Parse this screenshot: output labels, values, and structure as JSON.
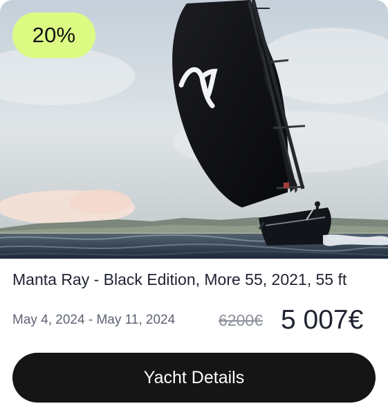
{
  "card": {
    "discount_badge": "20%",
    "yacht_title": "Manta Ray - Black Edition, More 55, 2021, 55 ft",
    "date_range": "May 4, 2024 - May 11, 2024",
    "original_price": "6200€",
    "current_price": "5 007€",
    "details_button_label": "Yacht Details"
  },
  "colors": {
    "badge_background": "#dcfb83",
    "button_background": "#151515",
    "price_text": "#1f2330",
    "muted_text": "#5d6470"
  },
  "icons": {
    "hero_image": "sailing-yacht-photo"
  }
}
